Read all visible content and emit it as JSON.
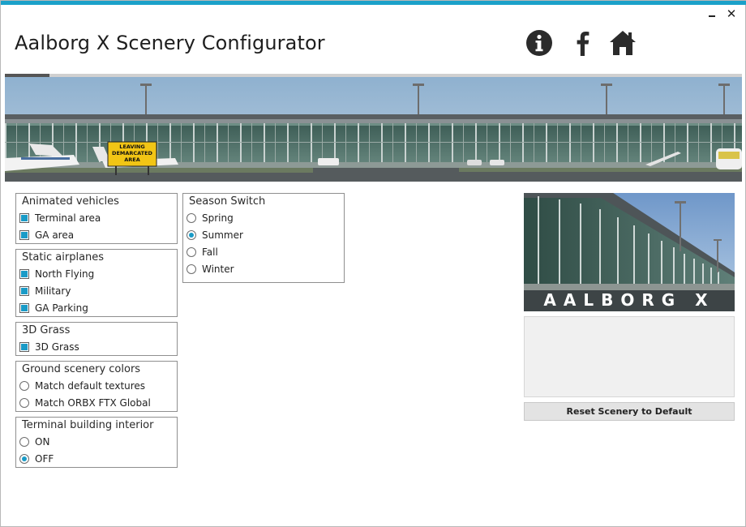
{
  "window": {
    "title": "Aalborg X Scenery Configurator",
    "accent_color": "#1ba1c9",
    "minimize_icon": "minimize-icon",
    "close_icon": "close-icon",
    "close_glyph": "✕"
  },
  "header_icons": [
    "info-icon",
    "facebook-icon",
    "home-icon"
  ],
  "banner": {
    "sign_line1": "LEAVING",
    "sign_line2": "DEMARCATED",
    "sign_line3": "AREA",
    "progress": 0.06
  },
  "groups": {
    "animated_vehicles": {
      "title": "Animated vehicles",
      "options": [
        {
          "label": "Terminal area",
          "checked": true
        },
        {
          "label": "GA area",
          "checked": true
        }
      ]
    },
    "static_airplanes": {
      "title": "Static airplanes",
      "options": [
        {
          "label": "North Flying",
          "checked": true
        },
        {
          "label": "Military",
          "checked": true
        },
        {
          "label": "GA Parking",
          "checked": true
        }
      ]
    },
    "grass_3d": {
      "title": "3D Grass",
      "options": [
        {
          "label": "3D Grass",
          "checked": true
        }
      ]
    },
    "ground_colors": {
      "title": "Ground scenery colors",
      "options": [
        {
          "label": "Match default textures",
          "selected": false
        },
        {
          "label": "Match ORBX FTX Global",
          "selected": false
        }
      ]
    },
    "terminal_interior": {
      "title": "Terminal building interior",
      "options": [
        {
          "label": "ON",
          "selected": false
        },
        {
          "label": "OFF",
          "selected": true
        }
      ]
    },
    "season_switch": {
      "title": "Season Switch",
      "options": [
        {
          "label": "Spring",
          "selected": false
        },
        {
          "label": "Summer",
          "selected": true
        },
        {
          "label": "Fall",
          "selected": false
        },
        {
          "label": "Winter",
          "selected": false
        }
      ]
    }
  },
  "preview": {
    "brand_text": "AALBORG X"
  },
  "reset_button": {
    "label": "Reset Scenery to Default"
  }
}
